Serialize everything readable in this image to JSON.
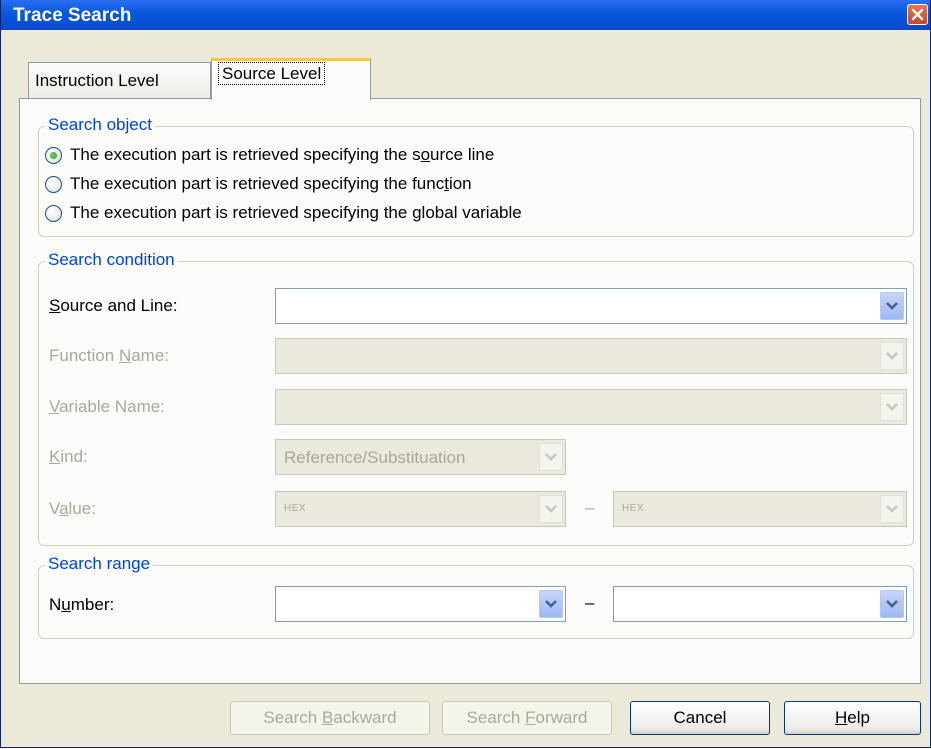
{
  "window": {
    "title": "Trace Search"
  },
  "tabs": [
    {
      "label": "Instruction Level",
      "active": false
    },
    {
      "label": "Source Level",
      "active": true
    }
  ],
  "search_object": {
    "legend": "Search object",
    "options": [
      {
        "pre": "The execution part is retrieved specifying the s",
        "u": "o",
        "post": "urce line",
        "selected": true
      },
      {
        "pre": "The execution part is retrieved specifying the func",
        "u": "t",
        "post": "ion",
        "selected": false
      },
      {
        "pre": "The execution part is retrieved specifying the ",
        "u": "g",
        "post": "lobal variable",
        "selected": false
      }
    ]
  },
  "search_condition": {
    "legend": "Search condition",
    "source_line": {
      "u": "S",
      "rest": "ource and Line:",
      "value": ""
    },
    "function_name": {
      "pre": "Function ",
      "u": "N",
      "post": "ame:",
      "value": ""
    },
    "variable_name": {
      "u": "V",
      "rest": "ariable Name:",
      "value": ""
    },
    "kind": {
      "u": "K",
      "rest": "ind:",
      "value": "Reference/Substituation"
    },
    "value": {
      "pre": "V",
      "u": "a",
      "post": "lue:",
      "from": "HEX",
      "dash": "–",
      "to": "HEX"
    }
  },
  "search_range": {
    "legend": "Search range",
    "number": {
      "pre": "N",
      "u": "u",
      "post": "mber:",
      "from": "",
      "dash": "–",
      "to": ""
    }
  },
  "buttons": {
    "search_backward": {
      "pre": "Search ",
      "u": "B",
      "post": "ackward",
      "enabled": false
    },
    "search_forward": {
      "pre": "Search ",
      "u": "F",
      "post": "orward",
      "enabled": false
    },
    "cancel": {
      "label": "Cancel",
      "enabled": true
    },
    "help": {
      "u": "H",
      "post": "elp",
      "enabled": true
    }
  },
  "icons": {
    "close": "close-icon",
    "dropdown": "chevron-down-icon"
  },
  "colors": {
    "title_bar": "#0a58e0",
    "group_legend": "#0046d5",
    "disabled_text": "#a9a899",
    "dialog_bg": "#ece9d8"
  }
}
